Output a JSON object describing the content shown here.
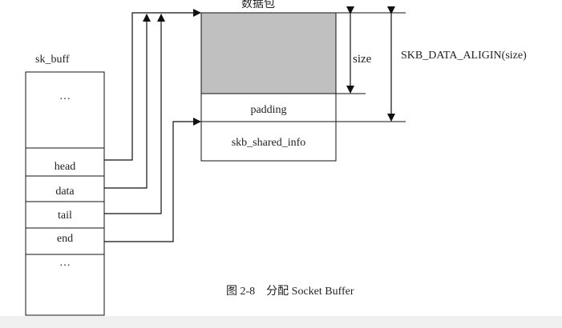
{
  "sk_buff": {
    "title": "sk_buff",
    "fields": [
      "…",
      "head",
      "data",
      "tail",
      "end",
      "…"
    ]
  },
  "packet": {
    "title": "数据包",
    "padding_label": "padding",
    "shared_info_label": "skb_shared_info"
  },
  "dimensions": {
    "size_label": "size",
    "aligned_label": "SKB_DATA_ALIGIN(size)"
  },
  "caption": "图 2-8　分配 Socket Buffer",
  "colors": {
    "line": "#111111",
    "packet_fill": "#c0c0c0",
    "text": "#222222"
  }
}
